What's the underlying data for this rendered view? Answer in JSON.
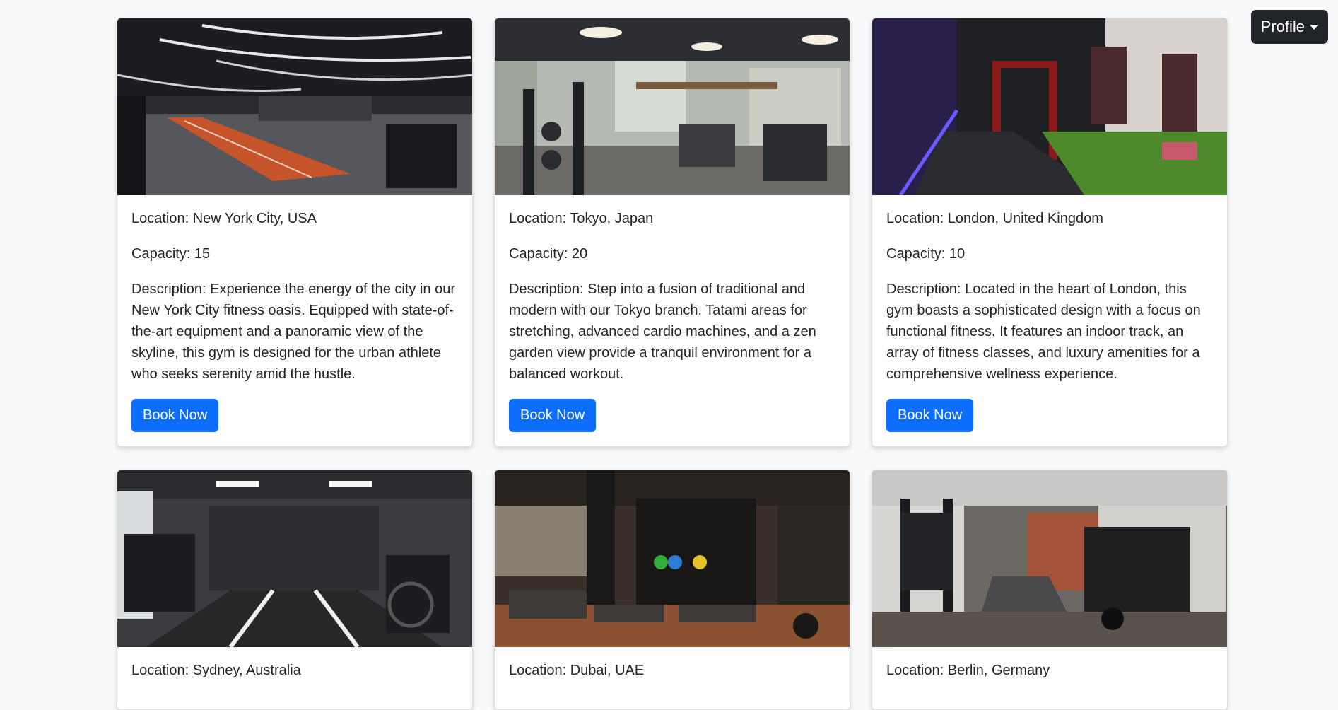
{
  "header": {
    "profile_label": "Profile"
  },
  "gyms": [
    {
      "location": "Location: New York City, USA",
      "capacity": "Capacity: 15",
      "description": "Description: Experience the energy of the city in our New York City fitness oasis. Equipped with state-of-the-art equipment and a panoramic view of the skyline, this gym is designed for the urban athlete who seeks serenity amid the hustle.",
      "button_label": "Book Now"
    },
    {
      "location": "Location: Tokyo, Japan",
      "capacity": "Capacity: 20",
      "description": "Description: Step into a fusion of traditional and modern with our Tokyo branch. Tatami areas for stretching, advanced cardio machines, and a zen garden view provide a tranquil environment for a balanced workout.",
      "button_label": "Book Now"
    },
    {
      "location": "Location: London, United Kingdom",
      "capacity": "Capacity: 10",
      "description": "Description: Located in the heart of London, this gym boasts a sophisticated design with a focus on functional fitness. It features an indoor track, an array of fitness classes, and luxury amenities for a comprehensive wellness experience.",
      "button_label": "Book Now"
    },
    {
      "location": "Location: Sydney, Australia"
    },
    {
      "location": "Location: Dubai, UAE"
    },
    {
      "location": "Location: Berlin, Germany"
    }
  ],
  "colors": {
    "primary": "#0d6efd",
    "dark": "#212529",
    "background": "#f8f9fa"
  }
}
